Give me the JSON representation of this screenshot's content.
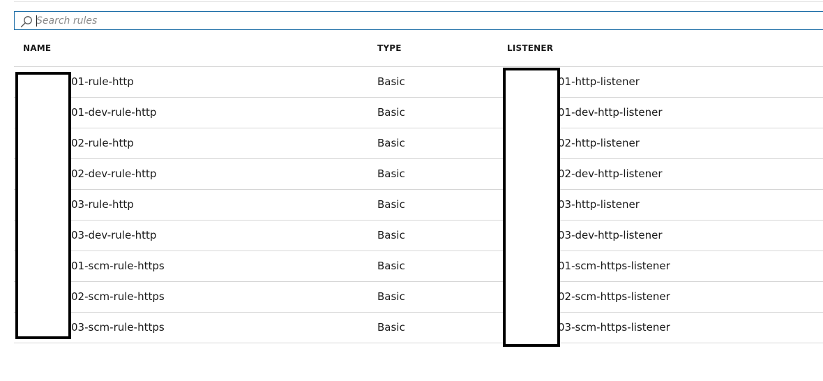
{
  "search": {
    "placeholder": "Search rules",
    "value": ""
  },
  "table": {
    "columns": [
      "NAME",
      "TYPE",
      "LISTENER"
    ],
    "rows": [
      {
        "name": "01-rule-http",
        "type": "Basic",
        "listener": "01-http-listener"
      },
      {
        "name": "01-dev-rule-http",
        "type": "Basic",
        "listener": "01-dev-http-listener"
      },
      {
        "name": "02-rule-http",
        "type": "Basic",
        "listener": "02-http-listener"
      },
      {
        "name": "02-dev-rule-http",
        "type": "Basic",
        "listener": "02-dev-http-listener"
      },
      {
        "name": "03-rule-http",
        "type": "Basic",
        "listener": "03-http-listener"
      },
      {
        "name": "03-dev-rule-http",
        "type": "Basic",
        "listener": "03-dev-http-listener"
      },
      {
        "name": "01-scm-rule-https",
        "type": "Basic",
        "listener": "01-scm-https-listener"
      },
      {
        "name": "02-scm-rule-https",
        "type": "Basic",
        "listener": "02-scm-https-listener"
      },
      {
        "name": "03-scm-rule-https",
        "type": "Basic",
        "listener": "03-scm-https-listener"
      }
    ]
  },
  "icons": {
    "search": "search-icon"
  },
  "colors": {
    "search_border": "#1f6fa8",
    "row_divider": "#d6d6d6",
    "redaction": "#000000"
  }
}
